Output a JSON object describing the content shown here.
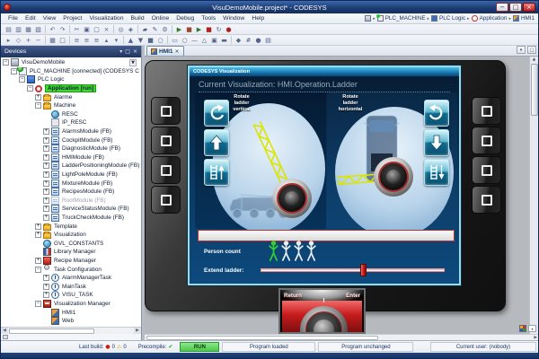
{
  "window": {
    "title": "VisuDemoMobile.project* - CODESYS",
    "controls": [
      {
        "name": "minimize",
        "glyph": "−"
      },
      {
        "name": "maximize",
        "glyph": "□"
      },
      {
        "name": "close",
        "glyph": "×"
      }
    ]
  },
  "menu": {
    "items": [
      "File",
      "Edit",
      "View",
      "Project",
      "Visualization",
      "Build",
      "Online",
      "Debug",
      "Tools",
      "Window",
      "Help"
    ]
  },
  "breadcrumb": {
    "root_icon": "project",
    "separator": "▸",
    "items": [
      {
        "label": "PLC_MACHINE",
        "icon": "device"
      },
      {
        "label": "PLC Logic",
        "icon": "plclogic"
      },
      {
        "label": "Application",
        "icon": "app"
      },
      {
        "label": "HMI1",
        "icon": "visu"
      }
    ]
  },
  "toolbar": {
    "row1": [
      {
        "name": "new-project",
        "glyph": "▤"
      },
      {
        "name": "open-project",
        "glyph": "▥"
      },
      {
        "name": "save",
        "glyph": "▦"
      },
      {
        "name": "print",
        "glyph": "▧"
      },
      {
        "name": "sep"
      },
      {
        "name": "undo",
        "glyph": "↶"
      },
      {
        "name": "redo",
        "glyph": "↷"
      },
      {
        "name": "sep"
      },
      {
        "name": "cut",
        "glyph": "✂"
      },
      {
        "name": "copy",
        "glyph": "▣"
      },
      {
        "name": "paste",
        "glyph": "▢"
      },
      {
        "name": "delete",
        "glyph": "×"
      },
      {
        "name": "sep"
      },
      {
        "name": "find",
        "glyph": "◎"
      },
      {
        "name": "replace",
        "glyph": "◈"
      },
      {
        "name": "sep"
      },
      {
        "name": "properties",
        "glyph": "▰"
      },
      {
        "name": "edit-object",
        "glyph": "✎"
      },
      {
        "name": "compile",
        "glyph": "⚙"
      },
      {
        "name": "sep"
      },
      {
        "name": "login",
        "glyph": "▶",
        "color": "#2f7a2f"
      },
      {
        "name": "logout",
        "glyph": "■",
        "color": "#9a4a2a"
      },
      {
        "name": "start",
        "glyph": "▶",
        "color": "#2f7a2f"
      },
      {
        "name": "stop",
        "glyph": "■",
        "color": "#b02020"
      },
      {
        "name": "single-cycle",
        "glyph": "↻"
      },
      {
        "name": "breakpoint",
        "glyph": "●",
        "color": "#b02020"
      }
    ],
    "row2": [
      {
        "name": "cursor",
        "glyph": "▸"
      },
      {
        "name": "move",
        "glyph": "◇"
      },
      {
        "name": "zoom-in",
        "glyph": "+"
      },
      {
        "name": "zoom-out",
        "glyph": "−"
      },
      {
        "name": "sep"
      },
      {
        "name": "grid",
        "glyph": "▦"
      },
      {
        "name": "frame",
        "glyph": "□"
      },
      {
        "name": "sep"
      },
      {
        "name": "align-left",
        "glyph": "≡"
      },
      {
        "name": "align-center",
        "glyph": "≡"
      },
      {
        "name": "align-right",
        "glyph": "≡"
      },
      {
        "name": "align-top",
        "glyph": "▴"
      },
      {
        "name": "align-bottom",
        "glyph": "▾"
      },
      {
        "name": "sep"
      },
      {
        "name": "bring-front",
        "glyph": "▲"
      },
      {
        "name": "send-back",
        "glyph": "▼"
      },
      {
        "name": "group",
        "glyph": "■"
      },
      {
        "name": "ungroup",
        "glyph": "○"
      },
      {
        "name": "sep"
      },
      {
        "name": "insert-rect",
        "glyph": "▭"
      },
      {
        "name": "insert-ellipse",
        "glyph": "○"
      },
      {
        "name": "insert-line",
        "glyph": "—"
      },
      {
        "name": "insert-polygon",
        "glyph": "△"
      },
      {
        "name": "insert-image",
        "glyph": "▣"
      },
      {
        "name": "insert-button",
        "glyph": "▬"
      },
      {
        "name": "sep"
      },
      {
        "name": "monitoring",
        "glyph": "◆"
      },
      {
        "name": "flow-control",
        "glyph": "#"
      },
      {
        "name": "watch",
        "glyph": "●"
      },
      {
        "name": "device-log",
        "glyph": "▤"
      }
    ]
  },
  "devices_panel": {
    "title": "Devices",
    "header_buttons": [
      {
        "name": "dock-menu",
        "glyph": "▾"
      },
      {
        "name": "auto-hide-pin",
        "glyph": "□"
      },
      {
        "name": "close-panel",
        "glyph": "×"
      }
    ],
    "root_combo_glyph": "▼",
    "tree": [
      {
        "label": "VisuDemoMobile",
        "level": 0,
        "icon": "project",
        "expand": "minus",
        "combo": true
      },
      {
        "label": "PLC_MACHINE [connected] (CODESYS C",
        "level": 1,
        "icon": "device",
        "expand": "minus"
      },
      {
        "label": "PLC Logic",
        "level": 2,
        "icon": "plclogic",
        "expand": "minus"
      },
      {
        "label": "Application [run]",
        "level": 3,
        "icon": "app",
        "expand": "minus",
        "highlight": true
      },
      {
        "label": "Alarme",
        "level": 4,
        "icon": "folder",
        "expand": "plus"
      },
      {
        "label": "Machine",
        "level": 4,
        "icon": "folder",
        "expand": "minus"
      },
      {
        "label": "RESC",
        "level": 5,
        "icon": "gvl",
        "expand": "none"
      },
      {
        "label": "IP_RESC",
        "level": 5,
        "icon": "itf",
        "expand": "none"
      },
      {
        "label": "AlarmsModule (FB)",
        "level": 5,
        "icon": "pou",
        "expand": "plus"
      },
      {
        "label": "CockpitModule (FB)",
        "level": 5,
        "icon": "pou",
        "expand": "plus"
      },
      {
        "label": "DiagnosticModule (FB)",
        "level": 5,
        "icon": "pou",
        "expand": "plus"
      },
      {
        "label": "HMIModule (FB)",
        "level": 5,
        "icon": "pou",
        "expand": "plus"
      },
      {
        "label": "LadderPositioningModule (FB)",
        "level": 5,
        "icon": "pou",
        "expand": "plus"
      },
      {
        "label": "LightPoleModule (FB)",
        "level": 5,
        "icon": "pou",
        "expand": "plus"
      },
      {
        "label": "MixtureModule (FB)",
        "level": 5,
        "icon": "pou",
        "expand": "plus"
      },
      {
        "label": "RecipesModule (FB)",
        "level": 5,
        "icon": "pou",
        "expand": "plus"
      },
      {
        "label": "RootModule (FB)",
        "level": 5,
        "icon": "pou",
        "expand": "plus",
        "dim": true
      },
      {
        "label": "ServiceStatusModule (FB)",
        "level": 5,
        "icon": "pou",
        "expand": "plus"
      },
      {
        "label": "TruckCheckModule (FB)",
        "level": 5,
        "icon": "pou",
        "expand": "plus"
      },
      {
        "label": "Template",
        "level": 4,
        "icon": "folder",
        "expand": "plus"
      },
      {
        "label": "Visualization",
        "level": 4,
        "icon": "folder",
        "expand": "plus"
      },
      {
        "label": "GVL_CONSTANTS",
        "level": 4,
        "icon": "gvl",
        "expand": "none"
      },
      {
        "label": "Library Manager",
        "level": 4,
        "icon": "lib",
        "expand": "none"
      },
      {
        "label": "Recipe Manager",
        "level": 4,
        "icon": "recipe",
        "expand": "plus"
      },
      {
        "label": "Task Configuration",
        "level": 4,
        "icon": "taskcfg",
        "expand": "minus"
      },
      {
        "label": "AlarmManagerTask",
        "level": 5,
        "icon": "task",
        "expand": "plus"
      },
      {
        "label": "MainTask",
        "level": 5,
        "icon": "task",
        "expand": "plus"
      },
      {
        "label": "VISU_TASK",
        "level": 5,
        "icon": "task",
        "expand": "plus"
      },
      {
        "label": "Visualization Manager",
        "level": 4,
        "icon": "vismgr",
        "expand": "minus"
      },
      {
        "label": "HMI1",
        "level": 5,
        "icon": "visu",
        "expand": "none"
      },
      {
        "label": "Web",
        "level": 5,
        "icon": "visu",
        "expand": "none"
      }
    ]
  },
  "editor": {
    "tab": {
      "label": "HMI1",
      "close_glyph": "×"
    },
    "tabrow_buttons": [
      {
        "name": "tab-list-dropdown",
        "glyph": "▾"
      },
      {
        "name": "float-window",
        "glyph": "□"
      }
    ]
  },
  "visualization": {
    "window_title": "CODESYS Visualization",
    "heading": "Current Visualization: HMI.Operation.Ladder",
    "left_group_label": "Rotate\nladder\nvertical",
    "right_group_label": "Rotate\nladder\nhorizontal",
    "person_count_label": "Person count",
    "person_count": {
      "total": 4,
      "active": 1
    },
    "extend_ladder_label": "Extend ladder:",
    "extend_ladder_percent": 56,
    "knob": {
      "return_label": "Return",
      "enter_label": "Enter"
    },
    "side_buttons_per_strip": 4,
    "colors": {
      "screen_border": "#9fd8e6",
      "ladder_yellow": "#dce400",
      "alarm_red": "#c03030",
      "active_person_green": "#2ed32e",
      "inactive_person": "#e8eef2"
    }
  },
  "status_bar": {
    "last_build": {
      "label": "Last build:",
      "errors": "0",
      "warnings": "0"
    },
    "precompile_label": "Precompile:",
    "precompile_ok_glyph": "✔",
    "run_state": "RUN",
    "program_loaded": "Program loaded",
    "program_unchanged": "Program unchanged",
    "current_user": "Current user: (nobody)"
  }
}
